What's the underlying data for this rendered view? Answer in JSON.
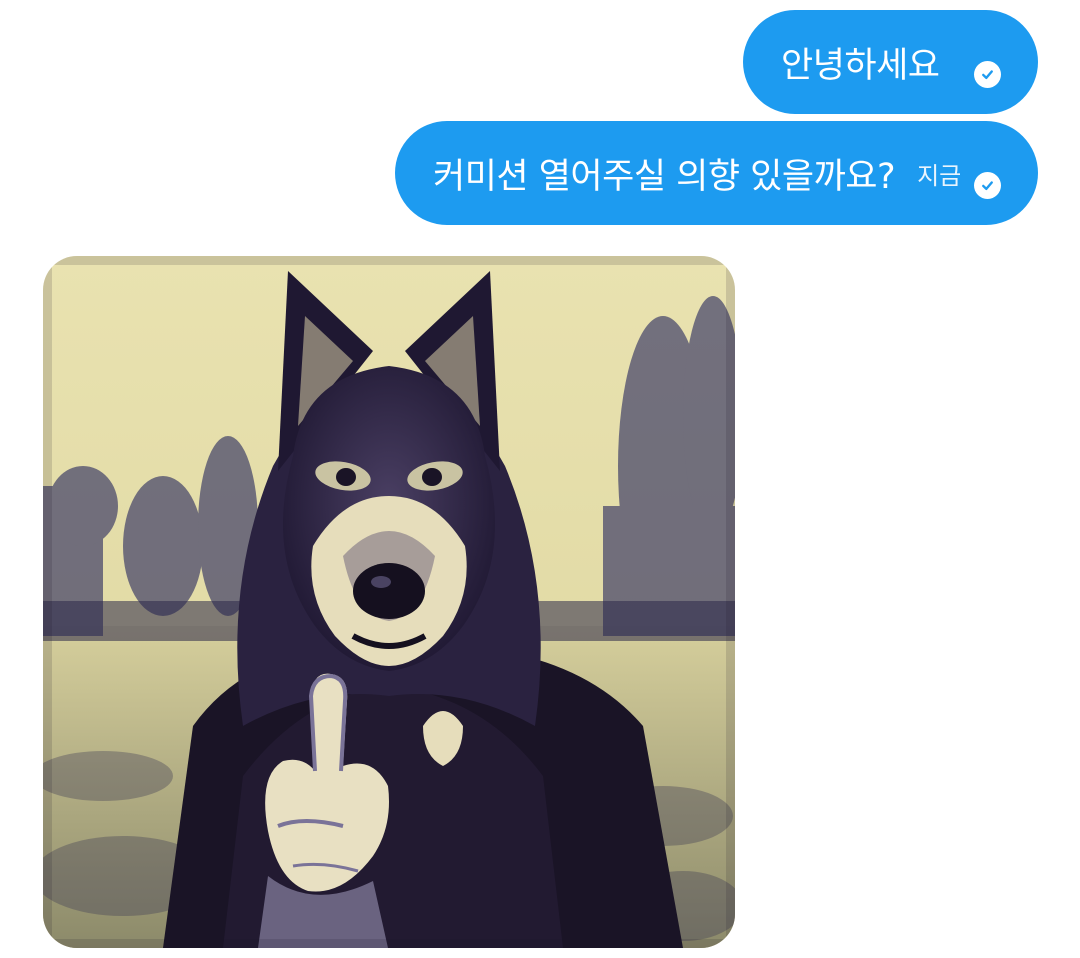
{
  "messages": [
    {
      "text": "안녕하세요",
      "time": "",
      "status_icon": "check-circle-icon"
    },
    {
      "text": "커미션 열어주실 의향 있을까요?",
      "time": "지금",
      "status_icon": "check-circle-icon"
    }
  ],
  "attachment": {
    "kind": "image",
    "subject": "wolf-head-figure-photo"
  },
  "colors": {
    "bubble": "#1d9bf0",
    "bubble_text": "#ffffff",
    "background": "#ffffff"
  }
}
